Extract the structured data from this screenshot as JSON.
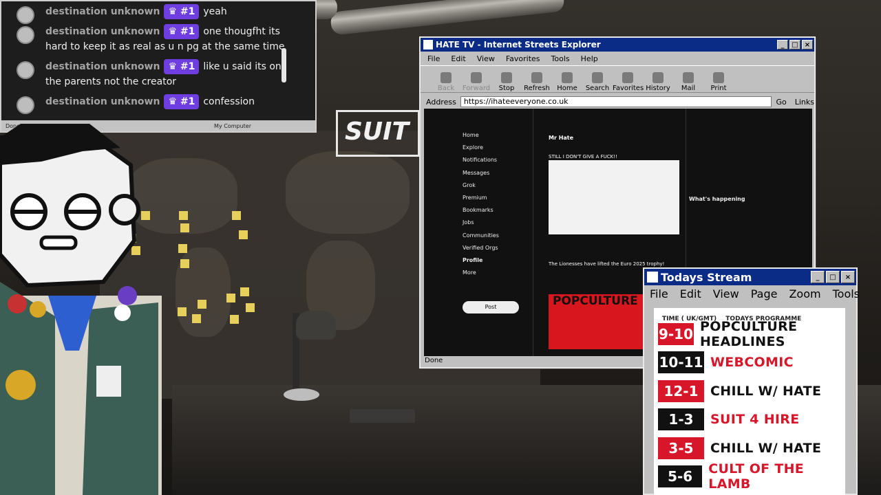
{
  "chat": {
    "messages": [
      {
        "user": "destination unknown",
        "badge": "#1",
        "text": "yeah"
      },
      {
        "user": "destination unknown",
        "badge": "#1",
        "text": "one thougfht its hard to keep it as real as u n pg at the same time"
      },
      {
        "user": "destination unknown",
        "badge": "#1",
        "text": "like u said its on the parents not the creator"
      },
      {
        "user": "destination unknown",
        "badge": "#1",
        "text": "confession"
      }
    ],
    "status_left": "Done",
    "status_right": "My Computer"
  },
  "scene": {
    "sign": "SUIT"
  },
  "browser": {
    "title": "HATE TV - Internet Streets Explorer",
    "menu": [
      "File",
      "Edit",
      "View",
      "Favorites",
      "Tools",
      "Help"
    ],
    "toolbar": [
      "Back",
      "Forward",
      "Stop",
      "Refresh",
      "Home",
      "Search",
      "Favorites",
      "History",
      "Mail",
      "Print"
    ],
    "address_label": "Address",
    "url": "https://ihateeveryone.co.uk",
    "go": "Go",
    "links": "Links",
    "status": "Done",
    "x": {
      "nav": [
        "Home",
        "Explore",
        "Notifications",
        "Messages",
        "Grok",
        "Premium",
        "Bookmarks",
        "Jobs",
        "Communities",
        "Verified Orgs",
        "Profile",
        "More"
      ],
      "post_button": "Post",
      "profile_name": "Mr Hate",
      "tweet_1": "STILL I DON'T GIVE A FUCK!!",
      "tweet_2": "The Lionesses have lifted the Euro 2025 trophy!",
      "banner": "POPCULTURE B",
      "trending": "What's happening"
    }
  },
  "stream": {
    "title": "Todays Stream",
    "menu": [
      "File",
      "Edit",
      "View",
      "Page",
      "Zoom",
      "Tools"
    ],
    "header_time": "TIME ( UK/GMT)",
    "header_programme": "TODAYS PROGRAMME",
    "rows": [
      {
        "time": "9-10",
        "programme": "POPCULTURE HEADLINES",
        "highlight": true
      },
      {
        "time": "10-11",
        "programme": "WEBCOMIC",
        "highlight": false
      },
      {
        "time": "12-1",
        "programme": "CHILL W/ HATE",
        "highlight": true
      },
      {
        "time": "1-3",
        "programme": "SUIT 4 HIRE",
        "highlight": false
      },
      {
        "time": "3-5",
        "programme": "CHILL W/ HATE",
        "highlight": true
      },
      {
        "time": "5-6",
        "programme": "CULT OF THE LAMB",
        "highlight": false
      }
    ],
    "colors": {
      "red": "#d8162a",
      "black": "#111111"
    }
  }
}
